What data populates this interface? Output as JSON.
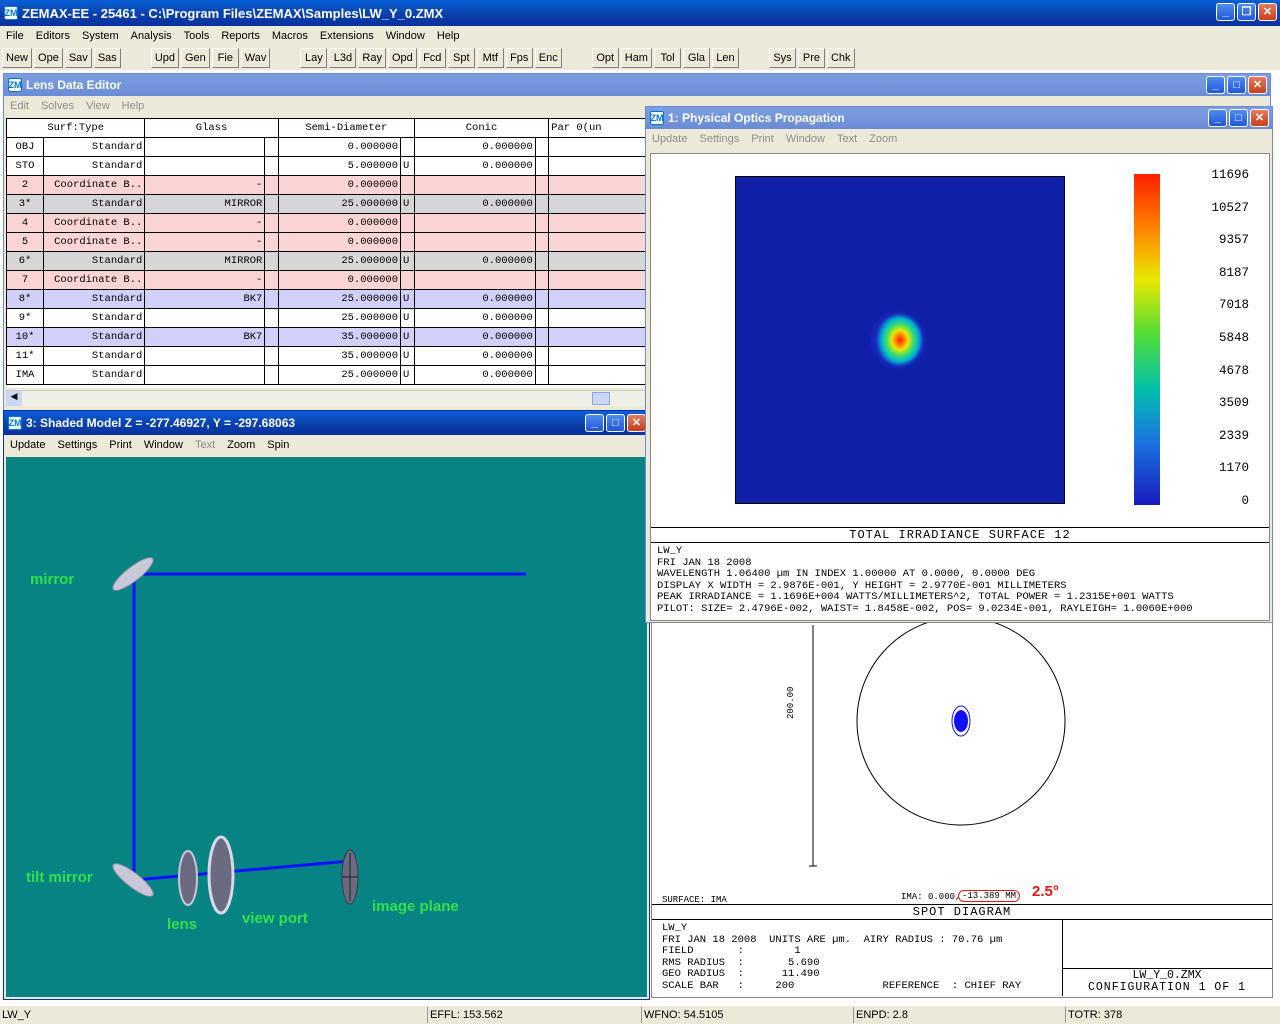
{
  "app": {
    "title": "ZEMAX-EE - 25461 - C:\\Program Files\\ZEMAX\\Samples\\LW_Y_0.ZMX"
  },
  "menu": [
    "File",
    "Editors",
    "System",
    "Analysis",
    "Tools",
    "Reports",
    "Macros",
    "Extensions",
    "Window",
    "Help"
  ],
  "toolbar": {
    "group1": [
      "New",
      "Ope",
      "Sav",
      "Sas"
    ],
    "group2": [
      "Upd",
      "Gen",
      "Fie",
      "Wav"
    ],
    "group3": [
      "Lay",
      "L3d",
      "Ray",
      "Opd",
      "Fcd",
      "Spt",
      "Mtf",
      "Fps",
      "Enc"
    ],
    "group4": [
      "Opt",
      "Ham",
      "Tol",
      "Gla",
      "Len"
    ],
    "group5": [
      "Sys",
      "Pre",
      "Chk"
    ]
  },
  "lde": {
    "title": "Lens Data Editor",
    "menu": [
      "Edit",
      "Solves",
      "View",
      "Help"
    ],
    "headers": [
      "Surf:Type",
      "Glass",
      "Semi-Diameter",
      "Conic",
      "Par 0(un"
    ],
    "rows": [
      {
        "surf": "OBJ",
        "type": "Standard",
        "glass": "",
        "semi": "0.000000",
        "flag": "",
        "conic": "0.000000",
        "style": "white"
      },
      {
        "surf": "STO",
        "type": "Standard",
        "glass": "",
        "semi": "5.000000",
        "flag": "U",
        "conic": "0.000000",
        "style": "white"
      },
      {
        "surf": "2",
        "type": "Coordinate B..",
        "glass": "-",
        "semi": "0.000000",
        "flag": "",
        "conic": "",
        "style": "pink"
      },
      {
        "surf": "3*",
        "type": "Standard",
        "glass": "MIRROR",
        "semi": "25.000000",
        "flag": "U",
        "conic": "0.000000",
        "style": "gray"
      },
      {
        "surf": "4",
        "type": "Coordinate B..",
        "glass": "-",
        "semi": "0.000000",
        "flag": "",
        "conic": "",
        "style": "pink"
      },
      {
        "surf": "5",
        "type": "Coordinate B..",
        "glass": "-",
        "semi": "0.000000",
        "flag": "",
        "conic": "",
        "style": "pink"
      },
      {
        "surf": "6*",
        "type": "Standard",
        "glass": "MIRROR",
        "semi": "25.000000",
        "flag": "U",
        "conic": "0.000000",
        "style": "gray"
      },
      {
        "surf": "7",
        "type": "Coordinate B..",
        "glass": "-",
        "semi": "0.000000",
        "flag": "",
        "conic": "",
        "style": "pink"
      },
      {
        "surf": "8*",
        "type": "Standard",
        "glass": "BK7",
        "semi": "25.000000",
        "flag": "U",
        "conic": "0.000000",
        "style": "blue"
      },
      {
        "surf": "9*",
        "type": "Standard",
        "glass": "",
        "semi": "25.000000",
        "flag": "U",
        "conic": "0.000000",
        "style": "white"
      },
      {
        "surf": "10*",
        "type": "Standard",
        "glass": "BK7",
        "semi": "35.000000",
        "flag": "U",
        "conic": "0.000000",
        "style": "blue"
      },
      {
        "surf": "11*",
        "type": "Standard",
        "glass": "",
        "semi": "35.000000",
        "flag": "U",
        "conic": "0.000000",
        "style": "white"
      },
      {
        "surf": "IMA",
        "type": "Standard",
        "glass": "",
        "semi": "25.000000",
        "flag": "U",
        "conic": "0.000000",
        "style": "white"
      }
    ]
  },
  "shaded": {
    "title": "3: Shaded Model Z = -277.46927, Y = -297.68063",
    "menu": [
      "Update",
      "Settings",
      "Print",
      "Window",
      "Text",
      "Zoom",
      "Spin"
    ],
    "labels": {
      "mirror": "mirror",
      "tilt_mirror": "tilt mirror",
      "lens": "lens",
      "view_port": "view port",
      "image_plane": "image plane"
    }
  },
  "pop": {
    "title": "1: Physical Optics Propagation",
    "menu": [
      "Update",
      "Settings",
      "Print",
      "Window",
      "Text",
      "Zoom"
    ],
    "scale": [
      "11696",
      "10527",
      "9357",
      "8187",
      "7018",
      "5848",
      "4678",
      "3509",
      "2339",
      "1170",
      "0"
    ],
    "caption": "TOTAL IRRADIANCE SURFACE 12",
    "info": [
      "LW_Y",
      "FRI JAN 18 2008",
      "WAVELENGTH 1.06400 µm IN INDEX 1.00000 AT 0.0000, 0.0000 DEG",
      "DISPLAY X WIDTH = 2.9876E-001, Y HEIGHT = 2.9770E-001 MILLIMETERS",
      "PEAK IRRADIANCE = 1.1696E+004 WATTS/MILLIMETERS^2, TOTAL POWER = 1.2315E+001 WATTS",
      "PILOT: SIZE= 2.4796E-002, WAIST= 1.8458E-002, POS= 9.0234E-001, RAYLEIGH= 1.0060E+000"
    ]
  },
  "spot": {
    "scale_label": "200.00",
    "surface": "SURFACE: IMA",
    "ima": "IMA: 0.000,",
    "ima_circled": "-13.389 MM",
    "annotation": "2.5°",
    "caption": "SPOT DIAGRAM",
    "info": [
      "LW_Y",
      "FRI JAN 18 2008  UNITS ARE µm.  AIRY RADIUS : 70.76 µm",
      "FIELD       :        1",
      "RMS RADIUS  :       5.690",
      "GEO RADIUS  :      11.490",
      "SCALE BAR   :     200              REFERENCE  : CHIEF RAY"
    ],
    "file": "LW_Y_0.ZMX",
    "config": "CONFIGURATION 1 OF 1"
  },
  "status": {
    "name": "LW_Y",
    "effl": "EFFL: 153.562",
    "wfno": "WFNO: 54.5105",
    "enpd": "ENPD: 2.8",
    "totr": "TOTR: 378"
  },
  "colors": {
    "title_active": "#0a3ea8",
    "title_inactive": "#7d9fe0",
    "model_bg": "#078383",
    "label_green": "#33e04a",
    "beam": "#1010ff",
    "pink_row": "#fbd5d5",
    "blue_row": "#d0d0f8",
    "annotation": "#e01818"
  }
}
